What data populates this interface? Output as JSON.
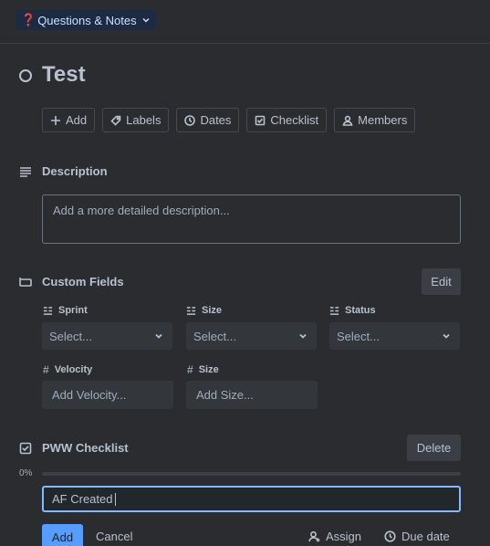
{
  "header": {
    "list_name": "Questions & Notes",
    "list_emoji": "❓"
  },
  "card": {
    "title": "Test"
  },
  "actions": [
    "Add",
    "Labels",
    "Dates",
    "Checklist",
    "Members"
  ],
  "description": {
    "heading": "Description",
    "placeholder": "Add a more detailed description..."
  },
  "custom_fields": {
    "heading": "Custom Fields",
    "edit_label": "Edit",
    "selects": [
      {
        "label": "Sprint",
        "value": "Select..."
      },
      {
        "label": "Size",
        "value": "Select..."
      },
      {
        "label": "Status",
        "value": "Select..."
      }
    ],
    "numbers": [
      {
        "label": "Velocity",
        "placeholder": "Add Velocity..."
      },
      {
        "label": "Size",
        "placeholder": "Add Size..."
      }
    ]
  },
  "checklist": {
    "heading": "PWW Checklist",
    "delete_label": "Delete",
    "progress_text": "0%",
    "progress": 0,
    "item_value": "AF Created",
    "add_label": "Add",
    "cancel_label": "Cancel",
    "assign_label": "Assign",
    "due_label": "Due date"
  },
  "colors": {
    "accent": "#579dff",
    "background": "#2b2c2f",
    "text": "#b6c2cf"
  }
}
